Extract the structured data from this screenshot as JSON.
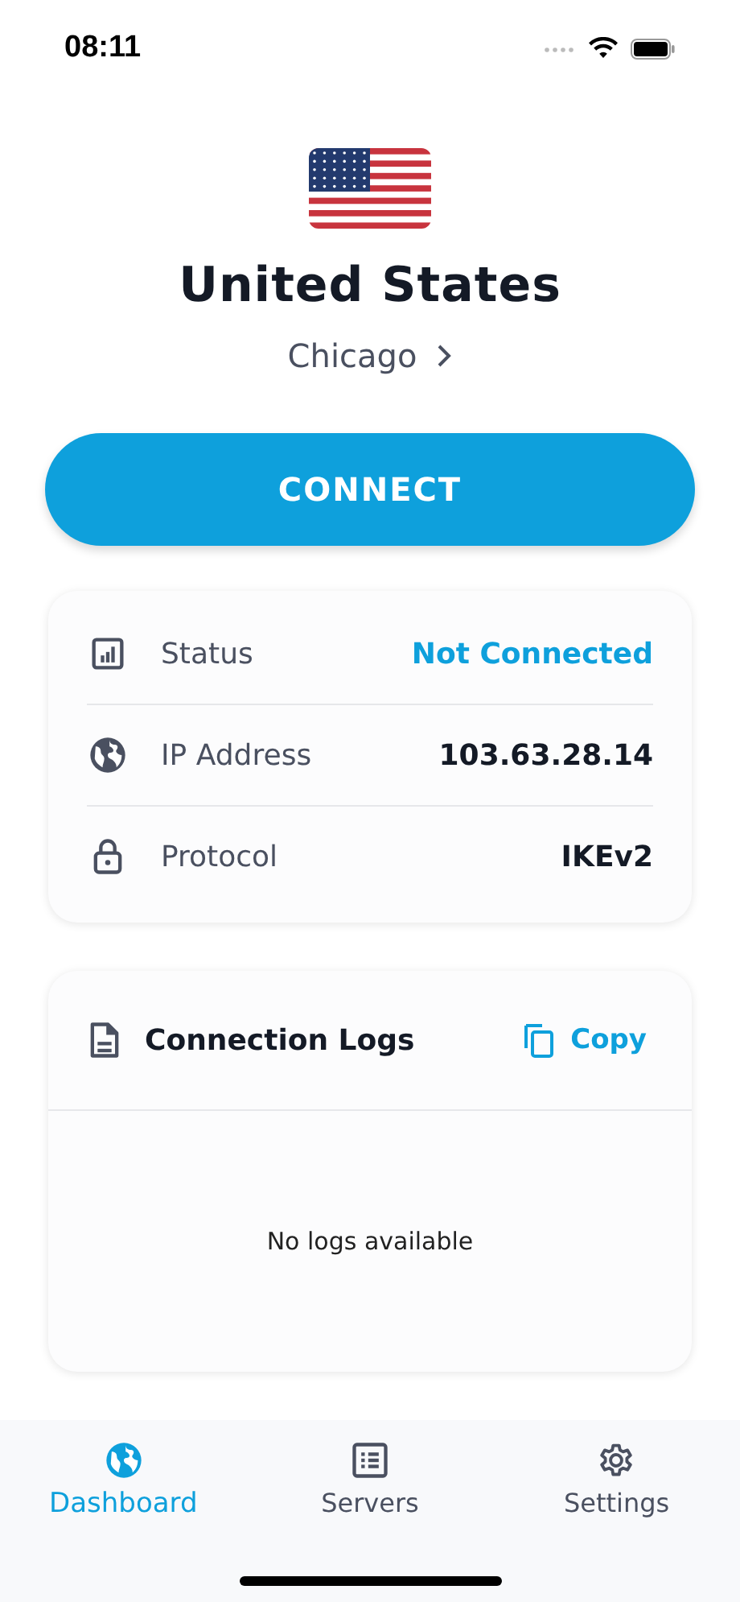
{
  "status_bar": {
    "time": "08:11"
  },
  "location": {
    "country": "United States",
    "city": "Chicago"
  },
  "connect_button": {
    "label": "CONNECT"
  },
  "info": [
    {
      "kind": "status",
      "label": "Status",
      "value": "Not Connected",
      "highlight": true
    },
    {
      "kind": "ip",
      "label": "IP Address",
      "value": "103.63.28.14",
      "highlight": false
    },
    {
      "kind": "protocol",
      "label": "Protocol",
      "value": "IKEv2",
      "highlight": false
    }
  ],
  "logs": {
    "title": "Connection Logs",
    "copy": "Copy",
    "empty": "No logs available"
  },
  "tabs": [
    {
      "kind": "dashboard",
      "label": "Dashboard",
      "selected": true
    },
    {
      "kind": "servers",
      "label": "Servers",
      "selected": false
    },
    {
      "kind": "settings",
      "label": "Settings",
      "selected": false
    }
  ]
}
